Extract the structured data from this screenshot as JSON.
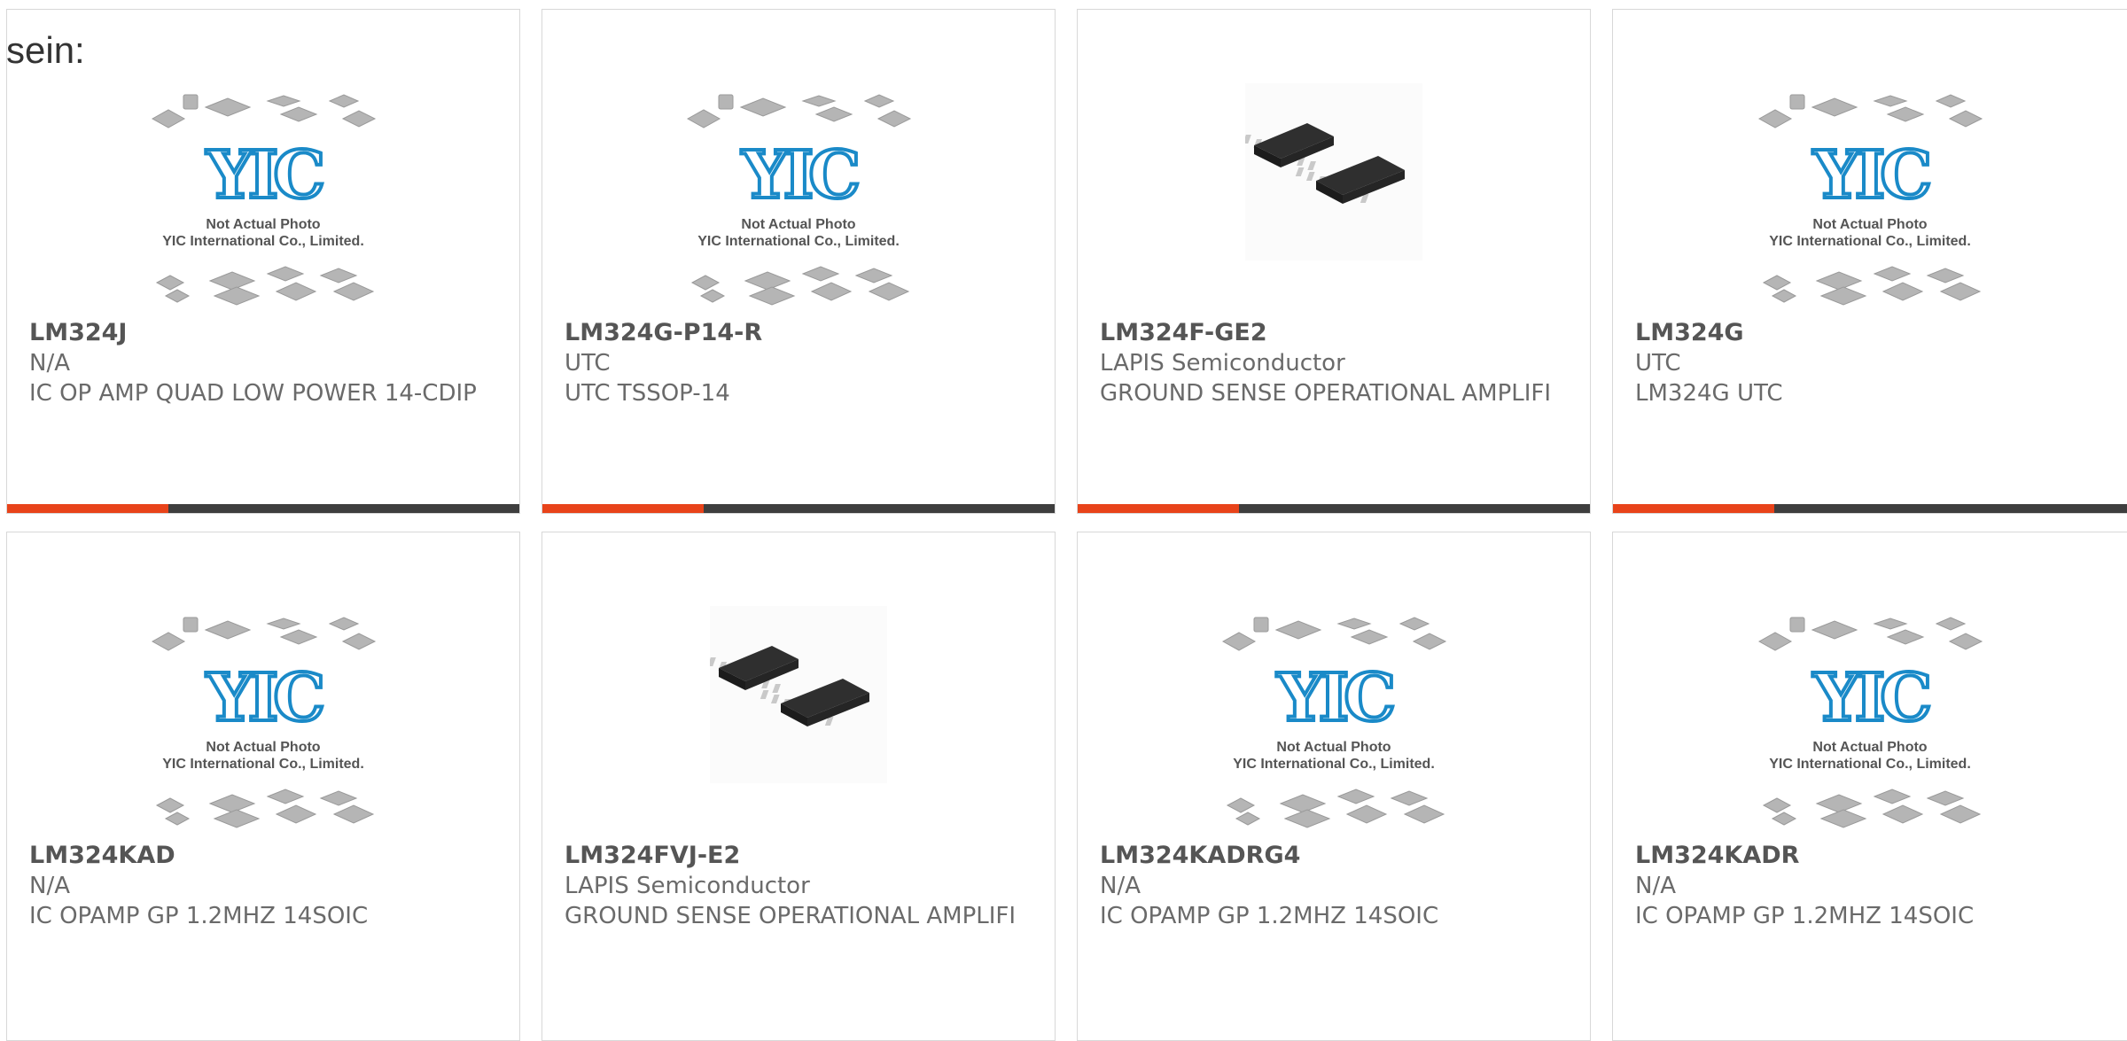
{
  "page": {
    "lead_text": "sein:"
  },
  "placeholder": {
    "logo": "YIC",
    "line1": "Not Actual Photo",
    "line2": "YIC International Co., Limited."
  },
  "products": [
    {
      "part": "LM324J",
      "manufacturer": "N/A",
      "description": "IC OP AMP QUAD LOW POWER 14-CDIP",
      "image": "placeholder"
    },
    {
      "part": "LM324G-P14-R",
      "manufacturer": "UTC",
      "description": "UTC TSSOP-14",
      "image": "placeholder"
    },
    {
      "part": "LM324F-GE2",
      "manufacturer": "LAPIS Semiconductor",
      "description": "GROUND SENSE OPERATIONAL AMPLIFI",
      "image": "chip-photo"
    },
    {
      "part": "LM324G",
      "manufacturer": "UTC",
      "description": "LM324G UTC",
      "image": "placeholder"
    },
    {
      "part": "LM324KAD",
      "manufacturer": "N/A",
      "description": "IC OPAMP GP 1.2MHZ 14SOIC",
      "image": "placeholder"
    },
    {
      "part": "LM324FVJ-E2",
      "manufacturer": "LAPIS Semiconductor",
      "description": "GROUND SENSE OPERATIONAL AMPLIFI",
      "image": "chip-photo"
    },
    {
      "part": "LM324KADRG4",
      "manufacturer": "N/A",
      "description": "IC OPAMP GP 1.2MHZ 14SOIC",
      "image": "placeholder"
    },
    {
      "part": "LM324KADR",
      "manufacturer": "N/A",
      "description": "IC OPAMP GP 1.2MHZ 14SOIC",
      "image": "placeholder"
    }
  ],
  "colors": {
    "accent": "#e8431a",
    "bar": "#3e3e3e",
    "logo": "#1a8ac8"
  }
}
